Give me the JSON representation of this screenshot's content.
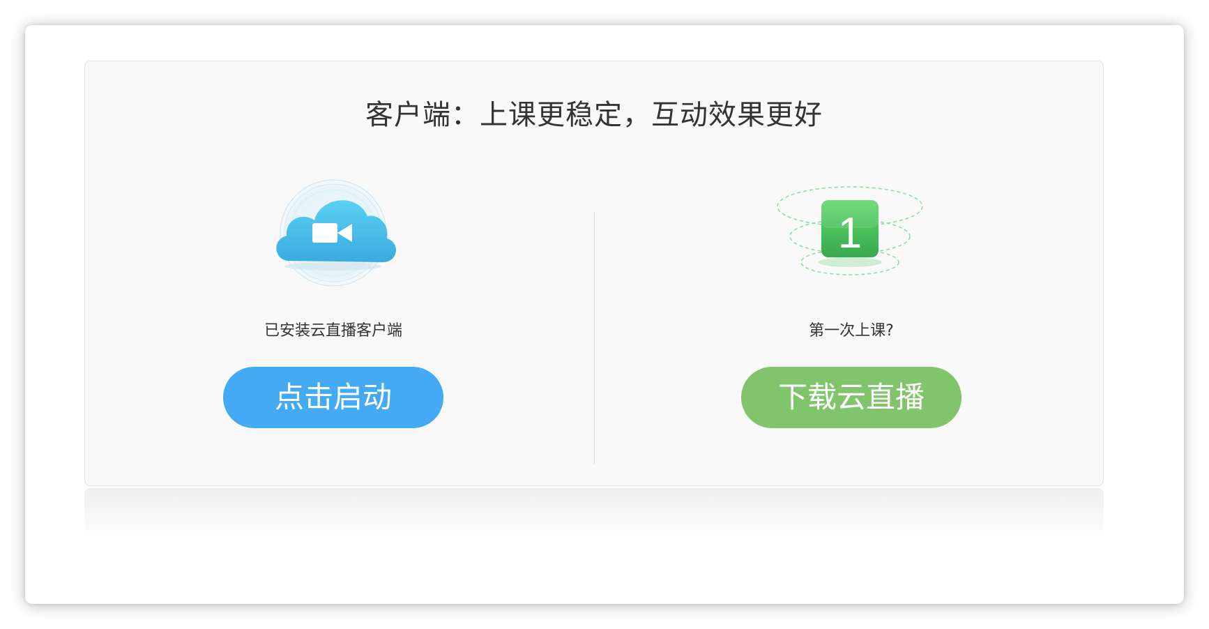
{
  "dialog": {
    "title": "客户端：上课更稳定，互动效果更好"
  },
  "left_option": {
    "icon": "cloud-camera-icon",
    "caption": "已安装云直播客户端",
    "button_label": "点击启动",
    "button_color": "#44aaf3"
  },
  "right_option": {
    "icon": "number-one-badge-icon",
    "badge_text": "1",
    "caption": "第一次上课?",
    "button_label": "下载云直播",
    "button_color": "#80c56b"
  },
  "colors": {
    "panel_background": "#f9f9f9",
    "title_text": "#333333",
    "badge_green": "#4cc35e"
  }
}
